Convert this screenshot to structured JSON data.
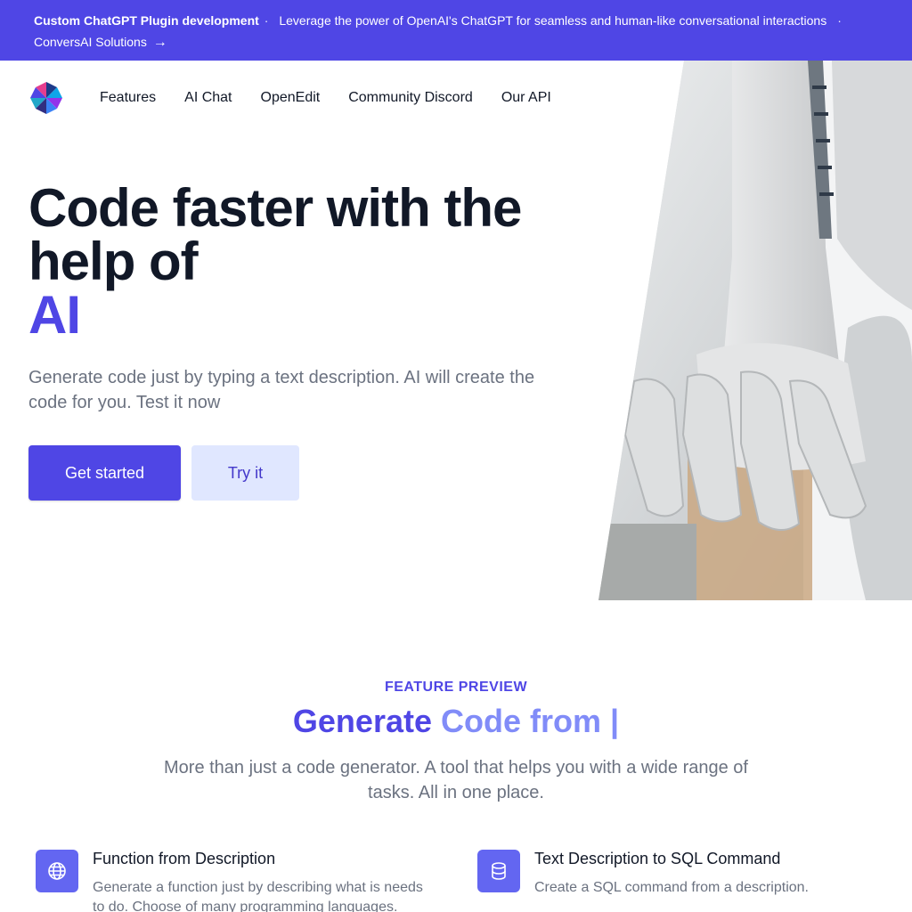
{
  "banner": {
    "title": "Custom ChatGPT Plugin development",
    "message": "Leverage the power of OpenAI's ChatGPT for seamless and human-like conversational interactions",
    "link_text": "ConversAI Solutions",
    "link_arrow": "→",
    "separator": "·"
  },
  "nav": {
    "logo_icon": "pinwheel-logo-icon",
    "items": [
      {
        "label": "Features"
      },
      {
        "label": "AI Chat"
      },
      {
        "label": "OpenEdit"
      },
      {
        "label": "Community Discord"
      },
      {
        "label": "Our API"
      }
    ]
  },
  "hero": {
    "title_line": "Code faster with the help of",
    "title_accent": "AI",
    "subtitle": "Generate code just by typing a text description. AI will create the code for you. Test it now",
    "primary_button": "Get started",
    "secondary_button": "Try it",
    "image": "robot-hand-photo"
  },
  "features_section": {
    "eyebrow": "FEATURE PREVIEW",
    "title_part1": "Generate",
    "title_part2": "Code from |",
    "subtitle": "More than just a code generator. A tool that helps you with a wide range of tasks. All in one place.",
    "items": [
      {
        "icon": "globe-icon",
        "title": "Function from Description",
        "description": "Generate a function just by describing what is needs to do. Choose of many programming languages."
      },
      {
        "icon": "database-icon",
        "title": "Text Description to SQL Command",
        "description": "Create a SQL command from a description."
      }
    ]
  },
  "colors": {
    "brand": "#4f46e5",
    "brand_light": "#818cf8",
    "button_secondary_bg": "#e0e7ff",
    "icon_bg": "#6366f1",
    "text_muted": "#6b7280"
  }
}
